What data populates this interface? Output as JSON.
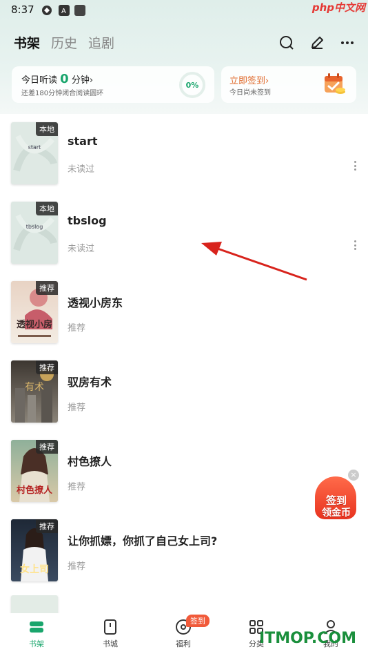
{
  "status_bar": {
    "time": "8:37",
    "watermark": "php中文网"
  },
  "header": {
    "tabs": [
      {
        "label": "书架"
      },
      {
        "label": "历史"
      },
      {
        "label": "追剧"
      }
    ]
  },
  "listen_card": {
    "prefix": "今日听读",
    "minutes": "0",
    "suffix": "分钟",
    "arrow": "›",
    "subtitle": "还差180分钟闭合阅读圆环",
    "progress_text": "0%",
    "progress": 0
  },
  "signin_card": {
    "title": "立即签到",
    "arrow": "›",
    "subtitle": "今日尚未签到"
  },
  "books": [
    {
      "title": "start",
      "subtitle": "未读过",
      "badge": "本地",
      "cover_text": "start",
      "cover_color": "#dfe9e4"
    },
    {
      "title": "tbslog",
      "subtitle": "未读过",
      "badge": "本地",
      "cover_text": "tbslog",
      "cover_color": "#dde8e3"
    },
    {
      "title": "透视小房东",
      "subtitle": "推荐",
      "badge": "推荐",
      "cover_text": "透视小房",
      "cover_color": "#efe3d6"
    },
    {
      "title": "驭房有术",
      "subtitle": "推荐",
      "badge": "推荐",
      "cover_text": "有术",
      "cover_color": "#5a5048"
    },
    {
      "title": "村色撩人",
      "subtitle": "推荐",
      "badge": "推荐",
      "cover_text": "村色撩人",
      "cover_color": "#7a9a86"
    },
    {
      "title": "让你抓嫖，你抓了自己女上司?",
      "subtitle": "推荐",
      "badge": "推荐",
      "cover_text": "女上司",
      "cover_color": "#2a3444"
    }
  ],
  "float_sign": {
    "line1": "签到",
    "line2": "领金币",
    "close": "×"
  },
  "nav": {
    "items": [
      {
        "label": "书架"
      },
      {
        "label": "书城"
      },
      {
        "label": "福利"
      },
      {
        "label": "分类"
      },
      {
        "label": "我的"
      }
    ],
    "badge": "签到"
  },
  "watermark_bottom": "ITMOP.COM",
  "colors": {
    "accent": "#19a56c",
    "signin": "#e06a2c",
    "arrow": "#d8231c"
  }
}
